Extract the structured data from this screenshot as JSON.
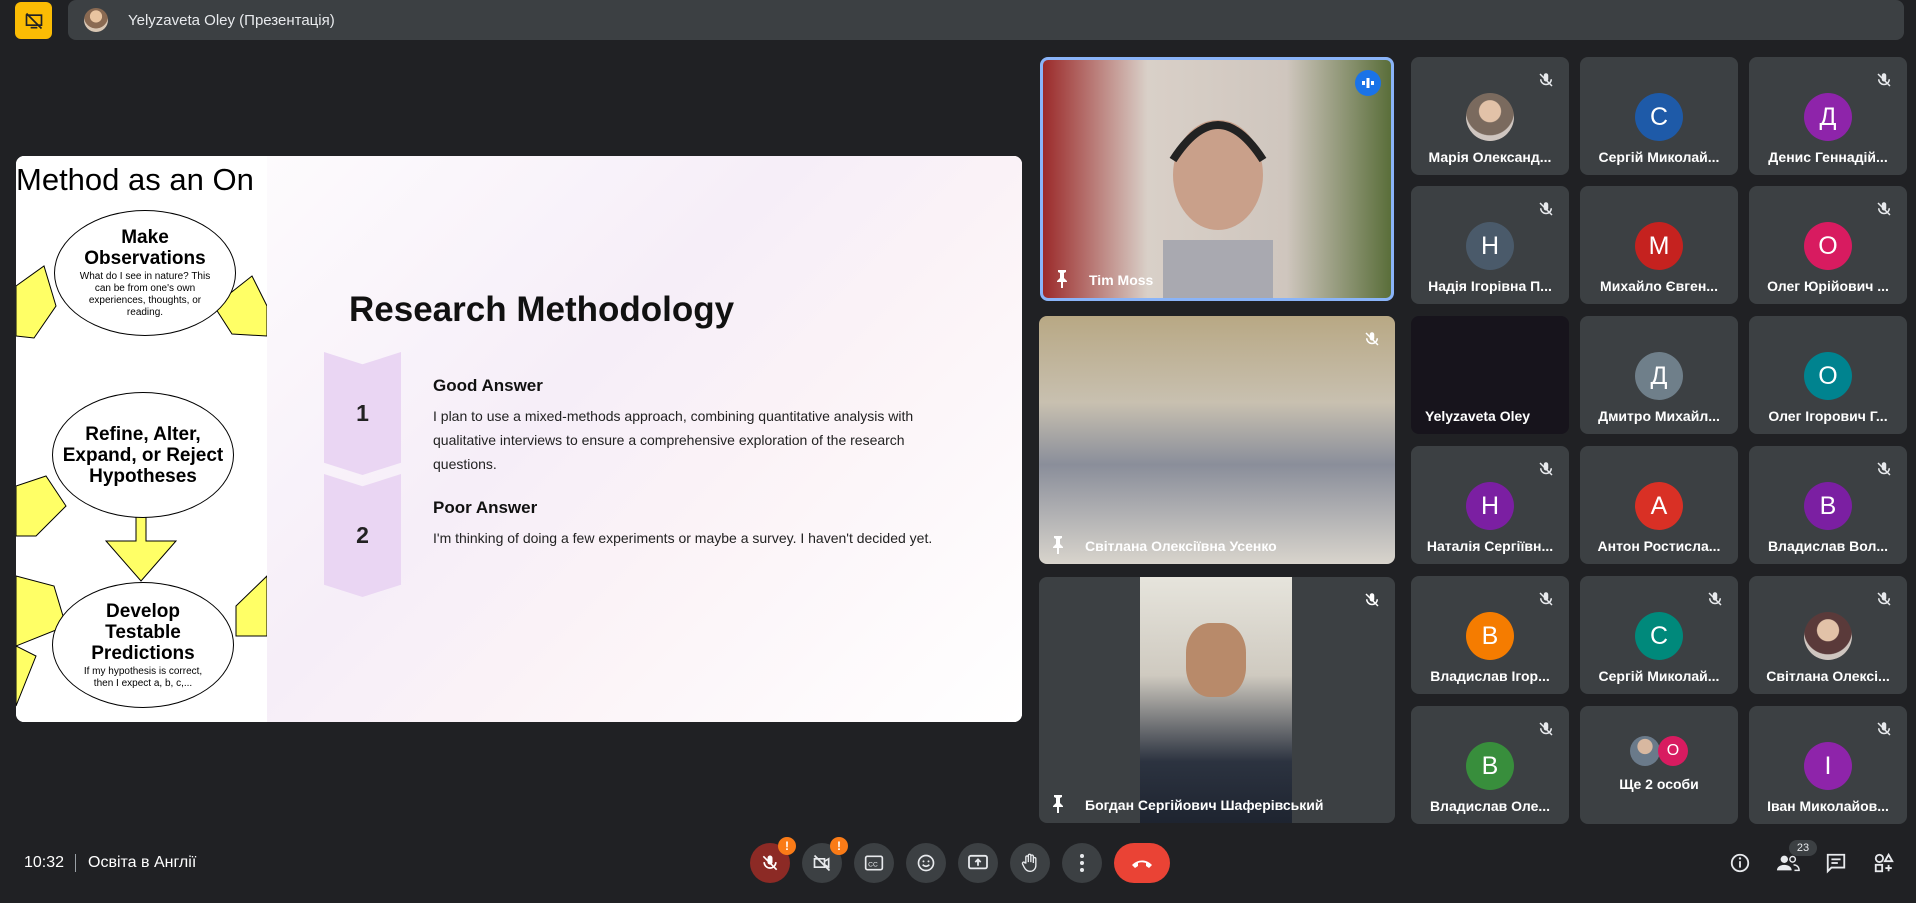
{
  "top_bar": {
    "presenter_name": "Yelyzaveta Oley (Презентація)"
  },
  "slide": {
    "left_heading": "Method as an On",
    "bubbles": {
      "observe": {
        "title": "Make Observations",
        "sub": "What do I see in nature? This can be from one's own experiences, thoughts, or reading."
      },
      "refine": {
        "title": "Refine, Alter, Expand, or Reject Hypotheses"
      },
      "predict": {
        "title": "Develop Testable Predictions",
        "sub": "If my hypothesis is correct, then I expect a, b, c,..."
      }
    },
    "heading": "Research Methodology",
    "answers": [
      {
        "num": "1",
        "title": "Good Answer",
        "body": "I plan to use a mixed-methods approach, combining quantitative analysis with qualitative interviews to ensure a comprehensive exploration of the research questions."
      },
      {
        "num": "2",
        "title": "Poor Answer",
        "body": "I'm thinking of doing a few experiments or maybe a survey. I haven't decided yet."
      }
    ]
  },
  "tiles": {
    "tim": "Tim Moss",
    "svitlana": "Світлана Олексіївна Усенко",
    "bohdan": "Богдан Сергійович Шаферівський",
    "yelyzaveta": "Yelyzaveta Oley",
    "others": [
      {
        "name": "Марія Олександ...",
        "initial": "",
        "color": "#7a6a5e"
      },
      {
        "name": "Сергій Миколай...",
        "initial": "С",
        "color": "#1e5aa8"
      },
      {
        "name": "Денис Геннадій...",
        "initial": "Д",
        "color": "#8e24aa"
      },
      {
        "name": "Надія Ігорівна П...",
        "initial": "Н",
        "color": "#4a5a6a"
      },
      {
        "name": "Михайло Євген...",
        "initial": "М",
        "color": "#c5221f"
      },
      {
        "name": "Олег Юрійович ...",
        "initial": "О",
        "color": "#d81b60"
      },
      {
        "name": "Дмитро Михайл...",
        "initial": "Д",
        "color": "#6f7f8a"
      },
      {
        "name": "Олег Ігорович Г...",
        "initial": "О",
        "color": "#00838f"
      },
      {
        "name": "Наталія Сергіївн...",
        "initial": "Н",
        "color": "#7b1fa2"
      },
      {
        "name": "Антон Ростисла...",
        "initial": "А",
        "color": "#d93025"
      },
      {
        "name": "Владислав Вол...",
        "initial": "В",
        "color": "#7b1fa2"
      },
      {
        "name": "Владислав Ігор...",
        "initial": "В",
        "color": "#f57c00"
      },
      {
        "name": "Сергій Миколай...",
        "initial": "С",
        "color": "#00897b"
      },
      {
        "name": "Світлана Олексі...",
        "initial": "",
        "color": "#5a3a3a"
      },
      {
        "name": "Владислав Оле...",
        "initial": "В",
        "color": "#388e3c"
      },
      {
        "name": "Ще 2 особи",
        "initial": "",
        "color": "#3c4043"
      },
      {
        "name": "Іван Миколайов...",
        "initial": "І",
        "color": "#8e24aa"
      }
    ],
    "more_initial": "О"
  },
  "bottom_bar": {
    "time": "10:32",
    "meeting_title": "Освіта в Англії",
    "badge_mic": "!",
    "badge_cam": "!",
    "participant_count": "23"
  },
  "colors": {
    "accent": "#8ab4f8",
    "hangup": "#ea4335",
    "present": "#fbbc04"
  }
}
